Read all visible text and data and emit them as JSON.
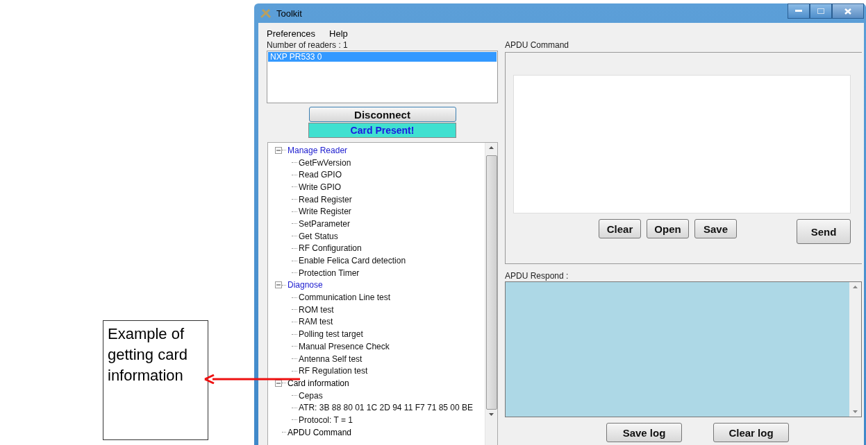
{
  "callout": {
    "text": "Example of getting card information"
  },
  "window": {
    "title": "Toolkit"
  },
  "menu": [
    "Preferences",
    "Help"
  ],
  "readers": {
    "label": "Number of readers : 1",
    "items": [
      {
        "label": "NXP PR533 0",
        "selected": true
      }
    ]
  },
  "connect_button": "Disconnect",
  "status": "Card Present!",
  "tree": [
    {
      "label": "Manage Reader",
      "expanded": true,
      "color": "#2020d0",
      "children": [
        {
          "label": "GetFwVersion"
        },
        {
          "label": "Read GPIO"
        },
        {
          "label": "Write GPIO"
        },
        {
          "label": "Read Register"
        },
        {
          "label": "Write Register"
        },
        {
          "label": "SetParameter"
        },
        {
          "label": "Get Status"
        },
        {
          "label": "RF Configuration"
        },
        {
          "label": "Enable Felica Card detection"
        },
        {
          "label": "Protection Timer"
        }
      ]
    },
    {
      "label": "Diagnose",
      "expanded": true,
      "color": "#2020d0",
      "children": [
        {
          "label": "Communication Line test"
        },
        {
          "label": "ROM test"
        },
        {
          "label": "RAM test"
        },
        {
          "label": "Polling test target"
        },
        {
          "label": "Manual Presence Check"
        },
        {
          "label": "Antenna Self test"
        },
        {
          "label": "RF Regulation test"
        }
      ]
    },
    {
      "label": "Card information",
      "expanded": true,
      "color": "#000000",
      "children": [
        {
          "label": "Cepas"
        },
        {
          "label": "ATR: 3B 88 80 01 1C 2D 94 11 F7 71 85 00 BE"
        },
        {
          "label": "Protocol: T = 1"
        }
      ]
    },
    {
      "label": "APDU Command",
      "color": "#000000"
    }
  ],
  "apdu_command": {
    "label": "APDU Command",
    "buttons": [
      "Clear",
      "Open",
      "Save"
    ],
    "send": "Send"
  },
  "apdu_respond": {
    "label": "APDU Respond :",
    "buttons": [
      "Save log",
      "Clear log"
    ]
  }
}
